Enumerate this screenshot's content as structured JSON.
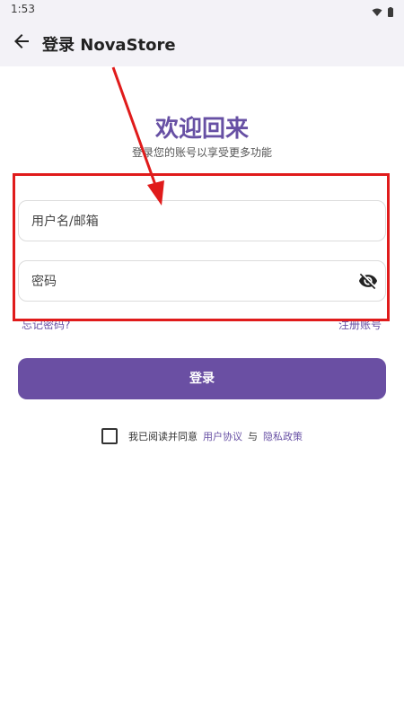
{
  "status_bar": {
    "time": "1:53"
  },
  "app_bar": {
    "title": "登录 NovaStore"
  },
  "main": {
    "welcome": "欢迎回来",
    "subtitle": "登录您的账号以享受更多功能",
    "username": {
      "placeholder": "用户名/邮箱",
      "value": ""
    },
    "password": {
      "placeholder": "密码",
      "value": ""
    },
    "forgot_password": "忘记密码?",
    "register": "注册账号",
    "login_button": "登录",
    "agreement": {
      "prefix": "我已阅读并同意",
      "user_agreement": "用户协议",
      "conjunction": "与",
      "privacy_policy": "隐私政策",
      "checked": false
    }
  },
  "colors": {
    "accent": "#6750a4",
    "button": "#6a4fa3",
    "annotation": "#e01b1b",
    "appbar": "#f3f2f7"
  },
  "icons": [
    "back-arrow-icon",
    "wifi-icon",
    "battery-icon",
    "visibility-off-icon"
  ]
}
